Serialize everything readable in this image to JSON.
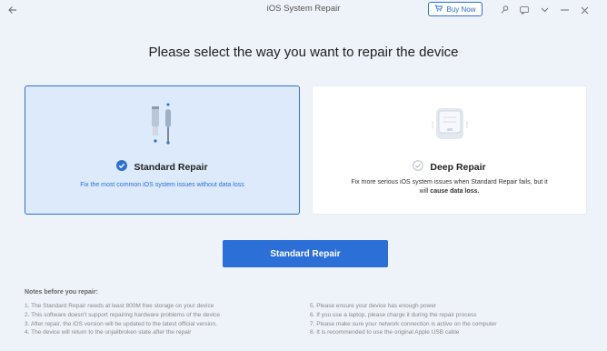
{
  "window": {
    "title": "iOS System Repair"
  },
  "toolbar": {
    "buy_now_label": "Buy Now"
  },
  "main": {
    "heading": "Please select the way you want to repair the device"
  },
  "cards": {
    "standard": {
      "title": "Standard Repair",
      "description": "Fix the most common iOS system issues without data loss"
    },
    "deep": {
      "title": "Deep Repair",
      "description_plain": "Fix more serious iOS system issues when Standard Repair fails, but it will",
      "description_bold": "cause data loss."
    }
  },
  "cta": {
    "label": "Standard Repair"
  },
  "notes": {
    "title": "Notes before you repair:",
    "left": [
      "1.  The Standard Repair needs at least 800M free storage on your device",
      "2.  This software doesn't support repairing hardware problems of the device",
      "3.  After repair, the iOS version will be updated to the latest official version.",
      "4.  The device will return to the unjailbroken state after the repair"
    ],
    "right": [
      "5.  Please ensure your device has enough power",
      "6.  If you use a laptop, please charge it during the repair process",
      "7.  Please make sure your network connection is active on the computer",
      "8.  It is recommended to use the original Apple USB cable"
    ]
  },
  "colors": {
    "accent": "#2c6fd6",
    "selected_card_bg": "#dceafb",
    "page_bg": "#eef3f9"
  },
  "icons": [
    "back-arrow-icon",
    "cart-icon",
    "key-icon",
    "feedback-icon",
    "chevron-down-icon",
    "minimize-icon",
    "close-icon",
    "toolkit-icon",
    "check-circle-icon",
    "device-icon"
  ]
}
